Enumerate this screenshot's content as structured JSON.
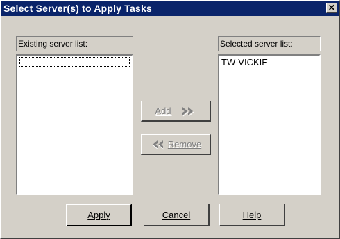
{
  "window": {
    "title": "Select Server(s) to Apply Tasks",
    "close_glyph": "✕"
  },
  "existing_list": {
    "label": "Existing server list:",
    "items": []
  },
  "selected_list": {
    "label": "Selected server list:",
    "items": [
      "TW-VICKIE"
    ]
  },
  "buttons": {
    "add": {
      "label": "Add",
      "enabled": false,
      "icon": "double-arrow-right-icon"
    },
    "remove": {
      "label": "Remove",
      "enabled": false,
      "icon": "double-arrow-left-icon"
    },
    "apply": "Apply",
    "cancel": "Cancel",
    "help": "Help"
  },
  "colors": {
    "titlebar": "#0a246a",
    "face": "#d4d0c8",
    "disabled_text": "#808080"
  }
}
